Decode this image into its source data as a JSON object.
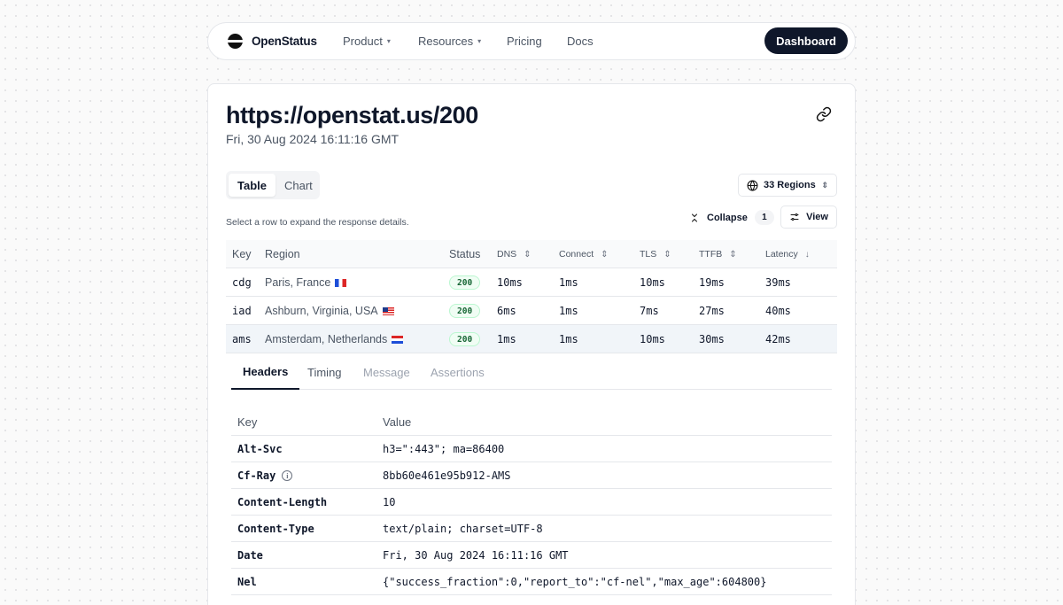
{
  "nav": {
    "brand": "OpenStatus",
    "items": [
      {
        "label": "Product",
        "dropdown": true
      },
      {
        "label": "Resources",
        "dropdown": true
      },
      {
        "label": "Pricing",
        "dropdown": false
      },
      {
        "label": "Docs",
        "dropdown": false
      }
    ],
    "cta": "Dashboard"
  },
  "page": {
    "title": "https://openstat.us/200",
    "date": "Fri, 30 Aug 2024 16:11:16 GMT"
  },
  "view_toggle": {
    "options": [
      "Table",
      "Chart"
    ],
    "active": "Table"
  },
  "regions_button": "33 Regions",
  "hint": "Select a row to expand the response details.",
  "collapse": {
    "label": "Collapse",
    "count": "1"
  },
  "view_button": "View",
  "table": {
    "columns": [
      "Key",
      "Region",
      "Status",
      "DNS",
      "Connect",
      "TLS",
      "TTFB",
      "Latency"
    ],
    "rows": [
      {
        "key": "cdg",
        "region": "Paris, France",
        "flag": "fr",
        "status": "200",
        "dns": "10ms",
        "connect": "1ms",
        "tls": "10ms",
        "ttfb": "19ms",
        "latency": "39ms"
      },
      {
        "key": "iad",
        "region": "Ashburn, Virginia, USA",
        "flag": "us",
        "status": "200",
        "dns": "6ms",
        "connect": "1ms",
        "tls": "7ms",
        "ttfb": "27ms",
        "latency": "40ms"
      },
      {
        "key": "ams",
        "region": "Amsterdam, Netherlands",
        "flag": "nl",
        "status": "200",
        "dns": "1ms",
        "connect": "1ms",
        "tls": "10ms",
        "ttfb": "30ms",
        "latency": "42ms"
      }
    ]
  },
  "detail_tabs": [
    {
      "label": "Headers",
      "state": "active"
    },
    {
      "label": "Timing",
      "state": "normal"
    },
    {
      "label": "Message",
      "state": "disabled"
    },
    {
      "label": "Assertions",
      "state": "disabled"
    }
  ],
  "headers_table": {
    "columns": [
      "Key",
      "Value"
    ],
    "rows": [
      {
        "key": "Alt-Svc",
        "value": "h3=\":443\"; ma=86400"
      },
      {
        "key": "Cf-Ray",
        "value": "8bb60e461e95b912-AMS",
        "info": true
      },
      {
        "key": "Content-Length",
        "value": "10"
      },
      {
        "key": "Content-Type",
        "value": "text/plain; charset=UTF-8"
      },
      {
        "key": "Date",
        "value": "Fri, 30 Aug 2024 16:11:16 GMT"
      },
      {
        "key": "Nel",
        "value": "{\"success_fraction\":0,\"report_to\":\"cf-nel\",\"max_age\":604800}"
      }
    ]
  },
  "colors": {
    "primary": "#0f172a",
    "success_bg": "#f0fdf4",
    "success_text": "#166534"
  }
}
